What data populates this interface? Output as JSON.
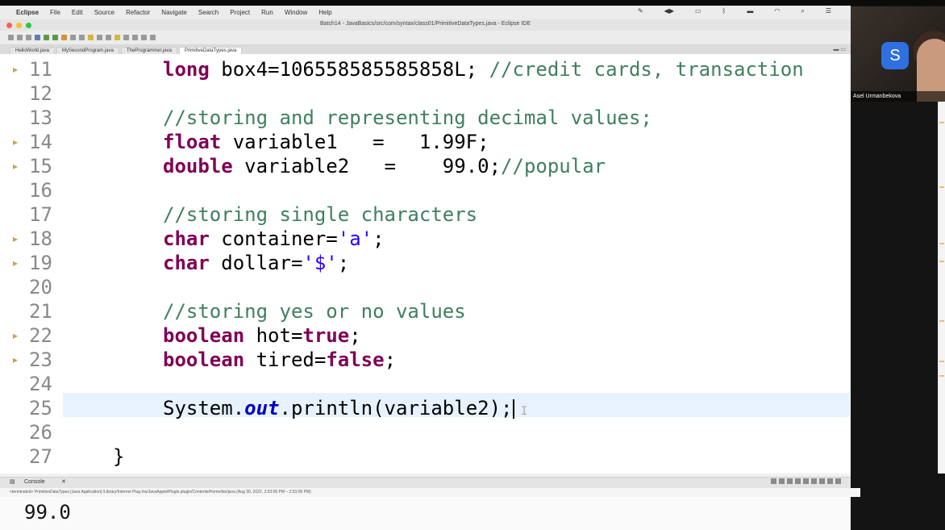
{
  "menubar": {
    "app": "Eclipse",
    "items": [
      "File",
      "Edit",
      "Source",
      "Refactor",
      "Navigate",
      "Search",
      "Project",
      "Run",
      "Window",
      "Help"
    ]
  },
  "window": {
    "title": "Batch14 - JavaBasics/src/com/syntax/class01/PrimitiveDataTypes.java - Eclipse IDE"
  },
  "tabs": [
    "HelloWorld.java",
    "MySecondProgram.java",
    "TheProgrammer.java",
    "PrimitiveDataTypes.java"
  ],
  "editor": {
    "lines": [
      {
        "num": "11",
        "segs": [
          [
            "long",
            "kw"
          ],
          [
            " box4=106558585585858L; ",
            ""
          ],
          [
            "//credit cards, transaction",
            "cm"
          ]
        ]
      },
      {
        "num": "12",
        "segs": []
      },
      {
        "num": "13",
        "segs": [
          [
            "//storing and representing decimal values;",
            "cm"
          ]
        ]
      },
      {
        "num": "14",
        "segs": [
          [
            "float",
            "kw"
          ],
          [
            " variable1   =   1.99F;",
            ""
          ]
        ]
      },
      {
        "num": "15",
        "segs": [
          [
            "double",
            "kw"
          ],
          [
            " variable2   =    99.0;",
            ""
          ],
          [
            "//popular",
            "cm"
          ]
        ]
      },
      {
        "num": "16",
        "segs": []
      },
      {
        "num": "17",
        "segs": [
          [
            "//storing single characters",
            "cm"
          ]
        ]
      },
      {
        "num": "18",
        "segs": [
          [
            "char",
            "kw"
          ],
          [
            " container=",
            ""
          ],
          [
            "'a'",
            "str"
          ],
          [
            ";",
            ""
          ]
        ]
      },
      {
        "num": "19",
        "segs": [
          [
            "char",
            "kw"
          ],
          [
            " dollar=",
            ""
          ],
          [
            "'$'",
            "str"
          ],
          [
            ";",
            ""
          ]
        ]
      },
      {
        "num": "20",
        "segs": []
      },
      {
        "num": "21",
        "segs": [
          [
            "//storing yes or no values",
            "cm"
          ]
        ]
      },
      {
        "num": "22",
        "segs": [
          [
            "boolean",
            "kw"
          ],
          [
            " hot=",
            ""
          ],
          [
            "true",
            "kw"
          ],
          [
            ";",
            ""
          ]
        ]
      },
      {
        "num": "23",
        "segs": [
          [
            "boolean",
            "kw"
          ],
          [
            " tired=",
            ""
          ],
          [
            "false",
            "kw"
          ],
          [
            ";",
            ""
          ]
        ]
      },
      {
        "num": "24",
        "segs": []
      },
      {
        "num": "25",
        "segs": [
          [
            "System.",
            ""
          ],
          [
            "out",
            "fld"
          ],
          [
            ".println(variable2);",
            ""
          ]
        ]
      },
      {
        "num": "26",
        "segs": []
      },
      {
        "num": "27",
        "segs": [
          [
            "}",
            ""
          ]
        ]
      }
    ]
  },
  "console": {
    "tab_label": "Console",
    "info": "<terminated> PrimitiveDataTypes [Java Application] /Library/Internet Plug-Ins/JavaAppletPlugin.plugin/Contents/Home/bin/java (Aug 30, 2022, 2:53:05 PM – 2:53:06 PM)",
    "output": "99.0"
  },
  "webcam": {
    "name": "Asel Urmanbekova"
  }
}
